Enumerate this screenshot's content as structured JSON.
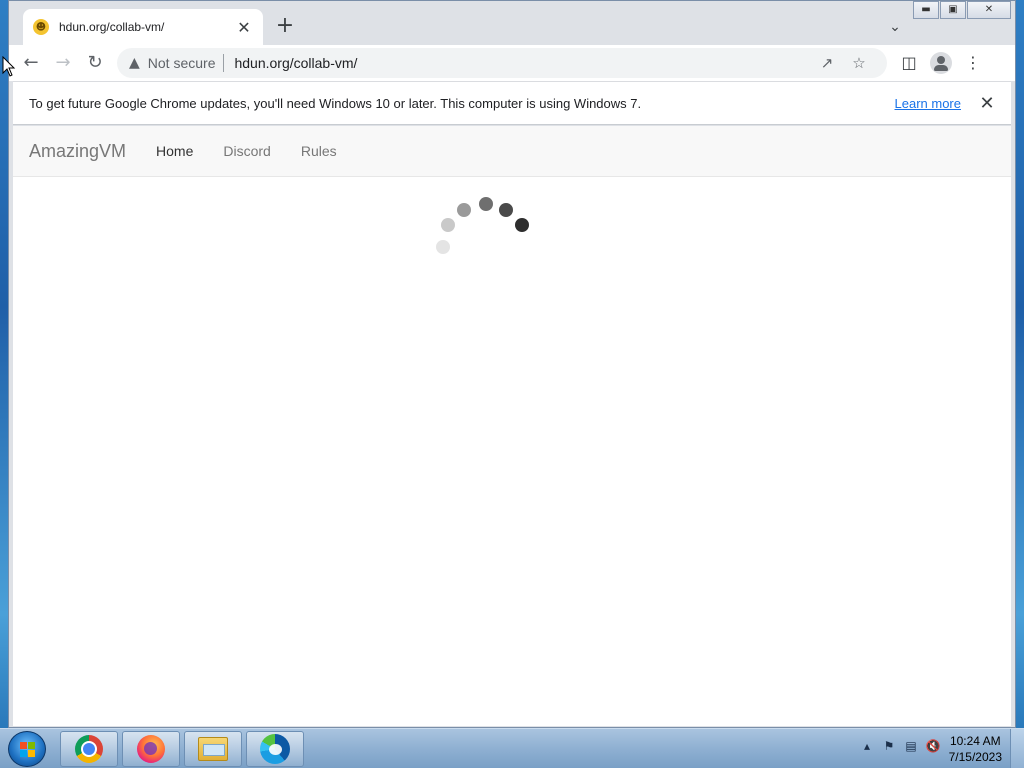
{
  "browser": {
    "tab_title": "hdun.org/collab-vm/",
    "tab_favicon": "smiley-icon",
    "new_tab_label": "+",
    "address": {
      "security_label": "Not secure",
      "url": "hdun.org/collab-vm/"
    }
  },
  "infobar": {
    "message": "To get future Google Chrome updates, you'll need Windows 10 or later. This computer is using Windows 7.",
    "learn_more": "Learn more"
  },
  "page": {
    "brand": "AmazingVM",
    "nav": [
      {
        "label": "Home",
        "active": true
      },
      {
        "label": "Discord",
        "active": false
      },
      {
        "label": "Rules",
        "active": false
      }
    ]
  },
  "taskbar": {
    "apps": [
      "chrome-icon",
      "firefox-icon",
      "file-explorer-icon",
      "edge-icon"
    ],
    "clock_time": "10:24 AM",
    "clock_date": "7/15/2023"
  }
}
